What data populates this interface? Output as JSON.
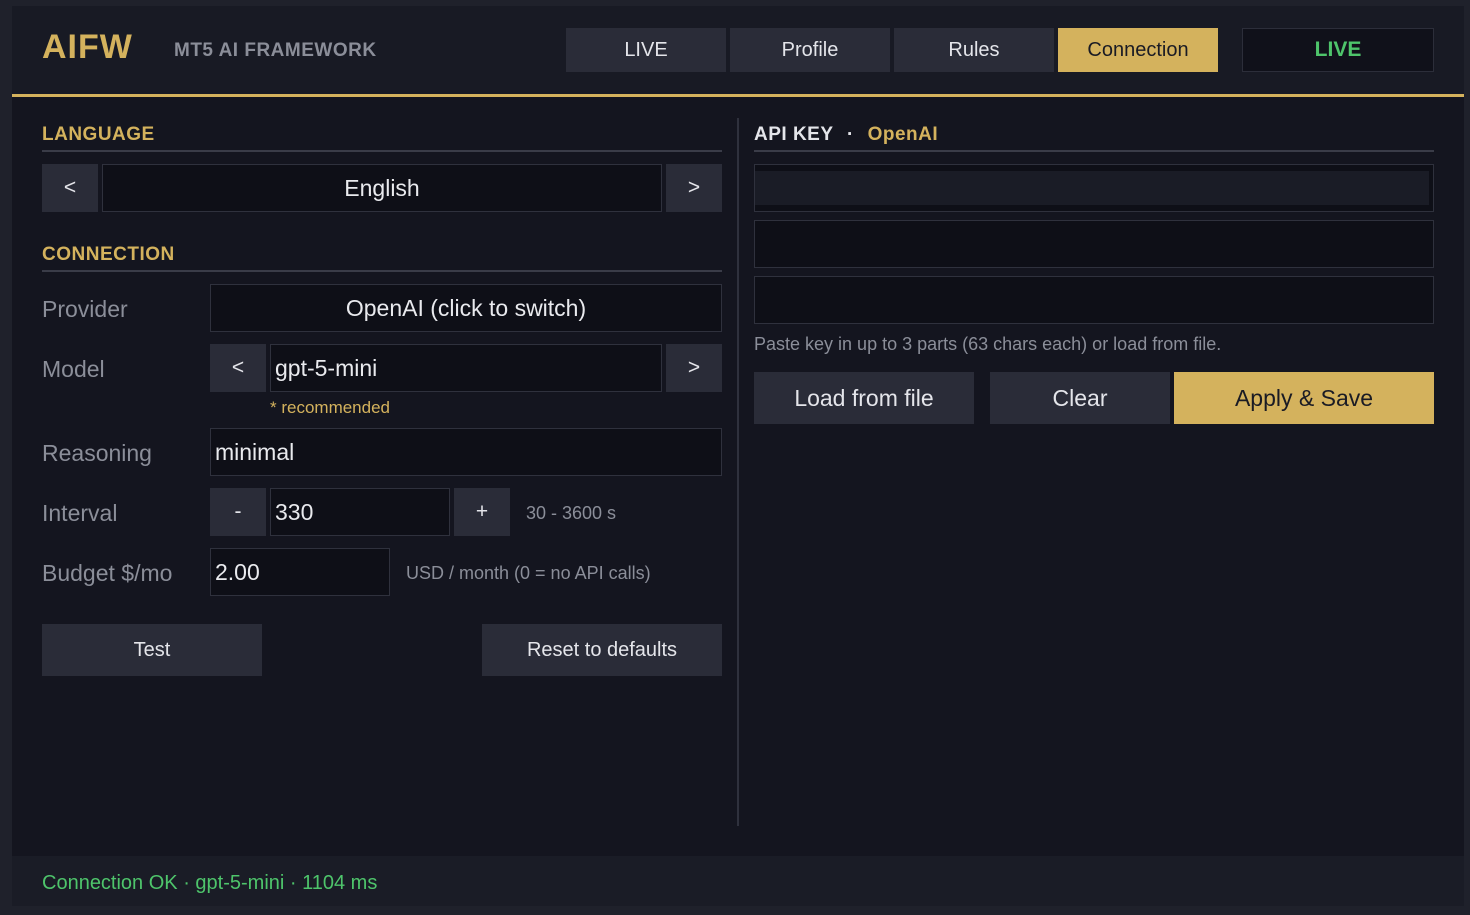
{
  "header": {
    "brand": "AIFW",
    "subtitle": "MT5 AI FRAMEWORK",
    "tabs": [
      {
        "label": "LIVE",
        "active": false
      },
      {
        "label": "Profile",
        "active": false
      },
      {
        "label": "Rules",
        "active": false
      },
      {
        "label": "Connection",
        "active": true
      }
    ],
    "status_badge": "LIVE"
  },
  "language": {
    "title": "LANGUAGE",
    "prev": "<",
    "value": "English",
    "next": ">"
  },
  "connection": {
    "title": "CONNECTION",
    "provider": {
      "label": "Provider",
      "value": "OpenAI   (click to switch)"
    },
    "model": {
      "label": "Model",
      "prev": "<",
      "value": "gpt-5-mini",
      "next": ">",
      "note": "* recommended"
    },
    "reasoning": {
      "label": "Reasoning",
      "value": "minimal"
    },
    "interval": {
      "label": "Interval",
      "minus": "-",
      "value": "330",
      "plus": "+",
      "range": "30 - 3600 s"
    },
    "budget": {
      "label": "Budget $/mo",
      "value": "2.00",
      "hint": "USD / month  (0 = no API calls)"
    },
    "test_label": "Test",
    "reset_label": "Reset to defaults"
  },
  "api_key": {
    "title": "API KEY",
    "separator": "·",
    "provider": "OpenAI",
    "hint": "Paste key in up to 3 parts (63 chars each) or load from file.",
    "load_label": "Load from file",
    "clear_label": "Clear",
    "apply_label": "Apply & Save"
  },
  "status": {
    "text": "Connection OK · gpt-5-mini · 1104 ms"
  },
  "colors": {
    "accent": "#d4b25d",
    "ok": "#4ec46b",
    "background": "#14151f"
  }
}
